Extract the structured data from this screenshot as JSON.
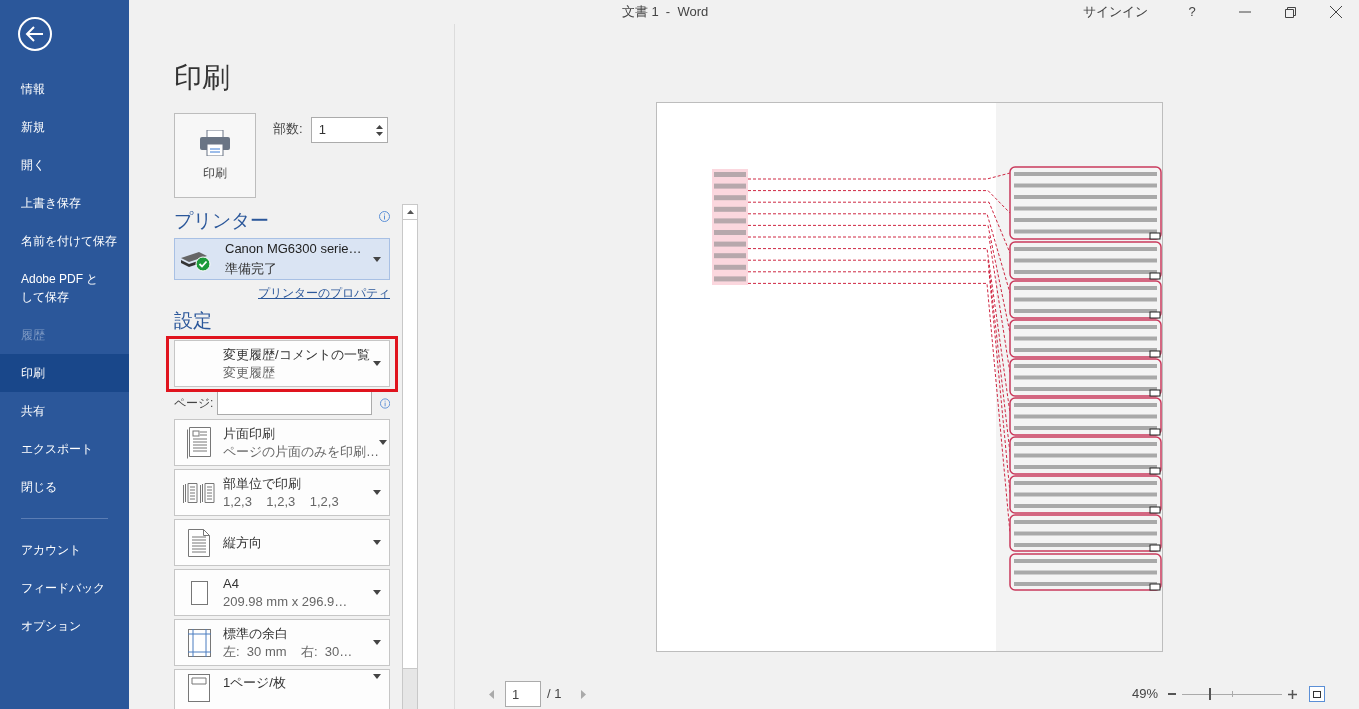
{
  "window": {
    "title": "文書 1  -  Word",
    "sign_in": "サインイン",
    "help": "?"
  },
  "backstage": {
    "items": [
      {
        "label": "情報",
        "selected": false,
        "disabled": false
      },
      {
        "label": "新規",
        "selected": false,
        "disabled": false
      },
      {
        "label": "開く",
        "selected": false,
        "disabled": false
      },
      {
        "label": "上書き保存",
        "selected": false,
        "disabled": false
      },
      {
        "label": "名前を付けて保存",
        "selected": false,
        "disabled": false
      },
      {
        "label": "Adobe PDF として保存",
        "selected": false,
        "disabled": false
      },
      {
        "label": "履歴",
        "selected": false,
        "disabled": true
      },
      {
        "label": "印刷",
        "selected": true,
        "disabled": false
      },
      {
        "label": "共有",
        "selected": false,
        "disabled": false
      },
      {
        "label": "エクスポート",
        "selected": false,
        "disabled": false
      },
      {
        "label": "閉じる",
        "selected": false,
        "disabled": false
      }
    ],
    "footer_items": [
      {
        "label": "アカウント",
        "selected": false
      },
      {
        "label": "フィードバック",
        "selected": false
      },
      {
        "label": "オプション",
        "selected": false
      }
    ]
  },
  "print": {
    "heading": "印刷",
    "print_button": "印刷",
    "copies_label": "部数:",
    "copies": "1",
    "printer_heading": "プリンター",
    "printer": {
      "name": "Canon MG6300 serie…",
      "status": "準備完了",
      "ready": true
    },
    "printer_properties": "プリンターのプロパティ",
    "settings_heading": "設定",
    "page_label": "ページ:",
    "settings": [
      {
        "kind": "list",
        "title": "変更履歴/コメントの一覧",
        "subtitle": "変更履歴",
        "highlighted": true
      },
      {
        "kind": "one-sided",
        "title": "片面印刷",
        "subtitle": "ページの片面のみを印刷…",
        "highlighted": false
      },
      {
        "kind": "collated",
        "title": "部単位で印刷",
        "subtitle": "1,2,3    1,2,3    1,2,3",
        "highlighted": false
      },
      {
        "kind": "portrait",
        "title": "縦方向",
        "highlighted": false
      },
      {
        "kind": "paper",
        "title": "A4",
        "subtitle": "209.98 mm x 296.9…",
        "highlighted": false
      },
      {
        "kind": "margins",
        "title": "標準の余白",
        "subtitle": "左:  30 mm    右:  30…",
        "highlighted": false
      },
      {
        "kind": "pages-per-sheet",
        "title": "1ページ/枚",
        "highlighted": false
      }
    ]
  },
  "navigation": {
    "page": "1",
    "total": "/ 1",
    "zoom": "49%",
    "zoom_slider": {
      "level": 0.27
    }
  }
}
